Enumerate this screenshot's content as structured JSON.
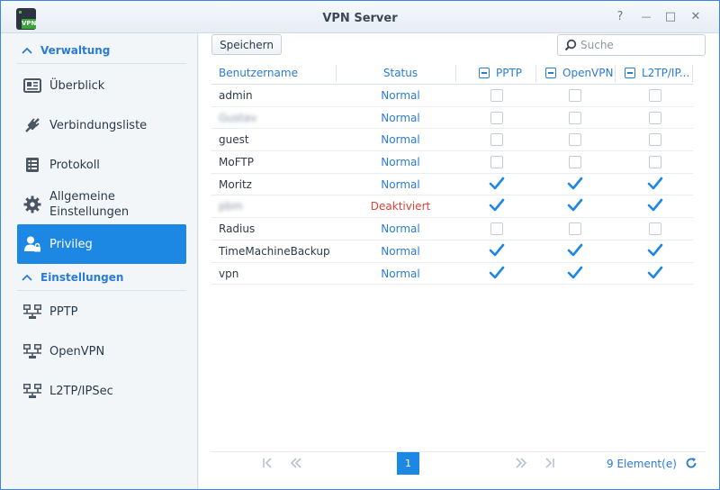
{
  "window": {
    "title": "VPN Server",
    "app_icon_label": "VPN",
    "controls": {
      "help": "?",
      "minimize": "—",
      "maximize": "□",
      "close": "✕"
    }
  },
  "sidebar": {
    "section1": "Verwaltung",
    "items1": [
      {
        "label": "Überblick",
        "icon": "overview-icon"
      },
      {
        "label": "Verbindungsliste",
        "icon": "connection-list-icon"
      },
      {
        "label": "Protokoll",
        "icon": "log-icon"
      },
      {
        "label": "Allgemeine Einstellungen",
        "line1": "Allgemeine",
        "line2": "Einstellungen",
        "icon": "gear-icon"
      },
      {
        "label": "Privileg",
        "icon": "privilege-user-icon",
        "active": true
      }
    ],
    "section2": "Einstellungen",
    "items2": [
      {
        "label": "PPTP",
        "icon": "network-icon"
      },
      {
        "label": "OpenVPN",
        "icon": "network-icon"
      },
      {
        "label": "L2TP/IPSec",
        "icon": "network-icon"
      }
    ]
  },
  "toolbar": {
    "save_label": "Speichern",
    "search_placeholder": "Suche"
  },
  "table": {
    "columns": [
      "Benutzername",
      "Status",
      "PPTP",
      "OpenVPN",
      "L2TP/IP..."
    ],
    "rows": [
      {
        "user": "admin",
        "status": "Normal",
        "pptp": false,
        "openvpn": false,
        "l2tp": false
      },
      {
        "user": "Gustav",
        "blurred": true,
        "status": "Normal",
        "pptp": false,
        "openvpn": false,
        "l2tp": false
      },
      {
        "user": "guest",
        "status": "Normal",
        "pptp": false,
        "openvpn": false,
        "l2tp": false
      },
      {
        "user": "MoFTP",
        "status": "Normal",
        "pptp": false,
        "openvpn": false,
        "l2tp": false
      },
      {
        "user": "Moritz",
        "status": "Normal",
        "pptp": true,
        "openvpn": true,
        "l2tp": true
      },
      {
        "user": "pbm",
        "blurred": true,
        "status": "Deaktiviert",
        "pptp": true,
        "openvpn": true,
        "l2tp": true
      },
      {
        "user": "Radius",
        "status": "Normal",
        "pptp": false,
        "openvpn": false,
        "l2tp": false
      },
      {
        "user": "TimeMachineBackup",
        "status": "Normal",
        "pptp": true,
        "openvpn": true,
        "l2tp": true
      },
      {
        "user": "vpn",
        "status": "Normal",
        "pptp": true,
        "openvpn": true,
        "l2tp": true
      }
    ]
  },
  "pager": {
    "current_page": "1",
    "count_label": "9 Element(e)"
  },
  "colors": {
    "accent": "#1d87e4",
    "link": "#2a7bd6",
    "disabled_status": "#d9433a",
    "window_border": "#3d86e0"
  }
}
